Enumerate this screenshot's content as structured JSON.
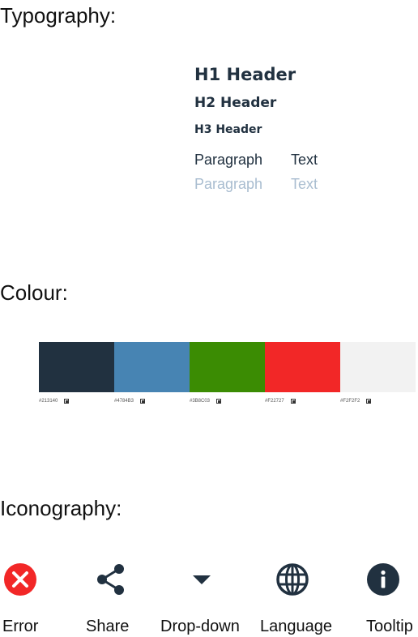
{
  "typography": {
    "title": "Typography:",
    "h1": "H1 Header",
    "h2": "H2 Header",
    "h3": "H3 Header",
    "paragraph_label": "Paragraph",
    "text_label": "Text"
  },
  "colour": {
    "title": "Colour:",
    "swatches": [
      {
        "hex": "#213140",
        "label": "#213140"
      },
      {
        "hex": "#4784B3",
        "label": "#4784B3"
      },
      {
        "hex": "#3B8C03",
        "label": "#3B8C03"
      },
      {
        "hex": "#F22727",
        "label": "#F22727"
      },
      {
        "hex": "#F2F2F2",
        "label": "#F2F2F2"
      }
    ]
  },
  "iconography": {
    "title": "Iconography:",
    "icons": [
      {
        "name": "error-icon",
        "label": "Error"
      },
      {
        "name": "share-icon",
        "label": "Share"
      },
      {
        "name": "dropdown-icon",
        "label": "Drop-down"
      },
      {
        "name": "language-icon",
        "label": "Language"
      },
      {
        "name": "tooltip-icon",
        "label": "Tooltip"
      }
    ]
  }
}
